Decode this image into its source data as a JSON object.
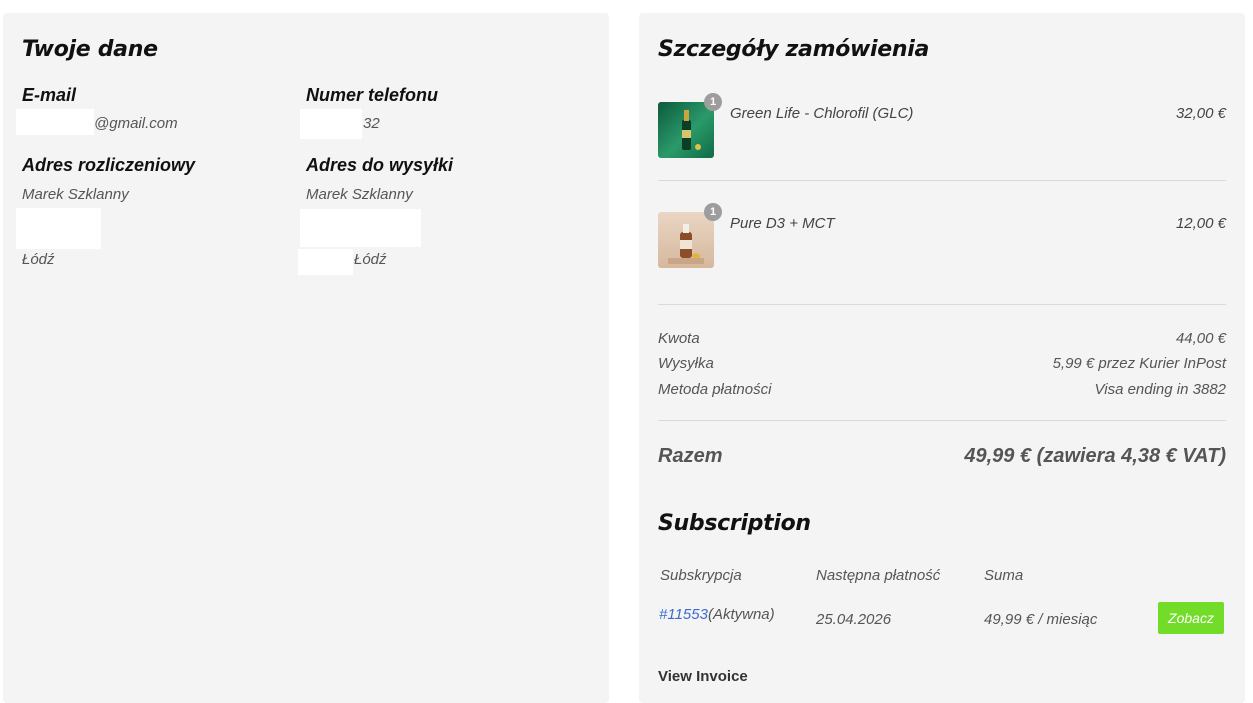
{
  "customer": {
    "title": "Twoje dane",
    "email_label": "E-mail",
    "email_value": "@gmail.com",
    "phone_label": "Numer telefonu",
    "phone_value": "32",
    "billing_label": "Adres rozliczeniowy",
    "billing_name": "Marek Szklanny",
    "billing_city": "Łódź",
    "shipping_label": "Adres do wysyłki",
    "shipping_name": "Marek Szklanny",
    "shipping_city": "Łódź"
  },
  "order": {
    "title": "Szczegóły zamówienia",
    "items": [
      {
        "qty": "1",
        "name": "Green Life - Chlorofil (GLC)",
        "price": "32,00 €",
        "thumb_color": "#1f8a5c"
      },
      {
        "qty": "1",
        "name": "Pure D3 + MCT",
        "price": "12,00 €",
        "thumb_color": "#d9c1ad"
      }
    ],
    "summary": {
      "amount_label": "Kwota",
      "amount_value": "44,00 €",
      "shipping_label": "Wysyłka",
      "shipping_value": "5,99 € przez Kurier InPost",
      "payment_label": "Metoda płatności",
      "payment_value": "Visa ending in 3882"
    },
    "total_label": "Razem",
    "total_value": "49,99 € (zawiera 4,38 € VAT)"
  },
  "subscription": {
    "title": "Subscription",
    "headers": [
      "Subskrypcja",
      "Następna płatność",
      "Suma"
    ],
    "row": {
      "id": "#11553",
      "status": "(Aktywna)",
      "next_payment": "25.04.2026",
      "total": "49,99 € / miesiąc",
      "button": "Zobacz"
    },
    "view_invoice": "View Invoice"
  },
  "colors": {
    "button": "#72dc28",
    "link": "#3d6bd0",
    "panel": "#f4f4f4"
  }
}
